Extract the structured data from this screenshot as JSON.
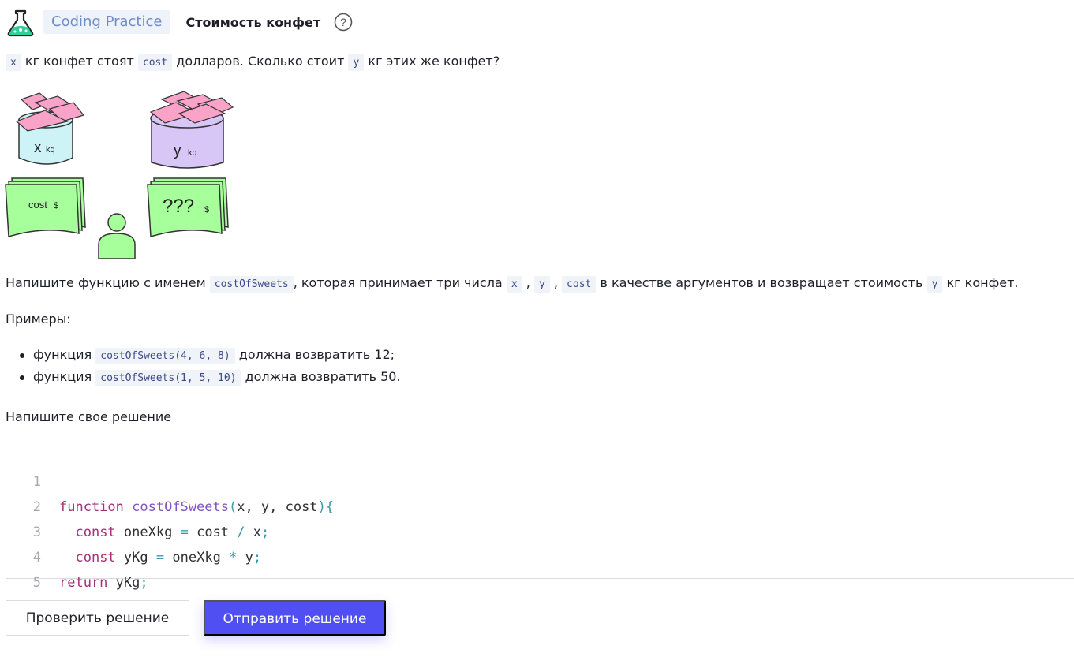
{
  "header": {
    "badge": "Coding Practice",
    "title": "Стоимость конфет"
  },
  "intro": {
    "var_x": "x",
    "part1": "кг конфет стоят",
    "var_cost": "cost",
    "part2": "долларов. Сколько стоит",
    "var_y": "y",
    "part3": "кг этих же конфет?"
  },
  "illustration": {
    "jar1_var": "x",
    "jar1_unit": "kq",
    "jar2_var": "y",
    "jar2_unit": "kq",
    "money1_label": "cost",
    "money1_unit": "$",
    "money2_label": "???",
    "money2_unit": "$",
    "colors": {
      "candy": "#f9a3c8",
      "jar1": "#cdf3f7",
      "jar2": "#d8c6f7",
      "money": "#a6ff9a",
      "person": "#a6ff9a"
    }
  },
  "task": {
    "part1": "Напишите функцию с именем",
    "fn_name": "costOfSweets",
    "part2": ", которая принимает три числа",
    "arg_x": "x",
    "comma1": ",",
    "arg_y": "y",
    "comma2": ",",
    "arg_cost": "cost",
    "part3": "в качестве аргументов и возвращает стоимость",
    "ret_y": "y",
    "part4": "кг конфет."
  },
  "examples_label": "Примеры:",
  "examples": [
    {
      "prefix": "функция",
      "call": "costOfSweets(4, 6, 8)",
      "suffix": "должна возвратить 12;"
    },
    {
      "prefix": "функция",
      "call": "costOfSweets(1, 5, 10)",
      "suffix": "должна возвратить 50."
    }
  ],
  "solution_label": "Напишите свое решение",
  "editor": {
    "line_numbers": [
      "1",
      "2",
      "3",
      "4",
      "5"
    ],
    "line1": {
      "kw": "function",
      "fn": "costOfSweets",
      "p_open": "(",
      "args": "x, y, cost",
      "p_close": ")",
      "brace": "{"
    },
    "line2": {
      "kw": "const",
      "name": "oneXkg",
      "eq": "=",
      "a": "cost",
      "op": "/",
      "b": "x",
      "end": ";"
    },
    "line3": {
      "kw": "const",
      "name": "yKg",
      "eq": "=",
      "a": "oneXkg",
      "op": "*",
      "b": "y",
      "end": ";"
    },
    "line4": {
      "kw": "return",
      "name": "yKg",
      "end": ";"
    },
    "line5": {
      "brace": "}"
    }
  },
  "buttons": {
    "check": "Проверить решение",
    "submit": "Отправить решение"
  }
}
